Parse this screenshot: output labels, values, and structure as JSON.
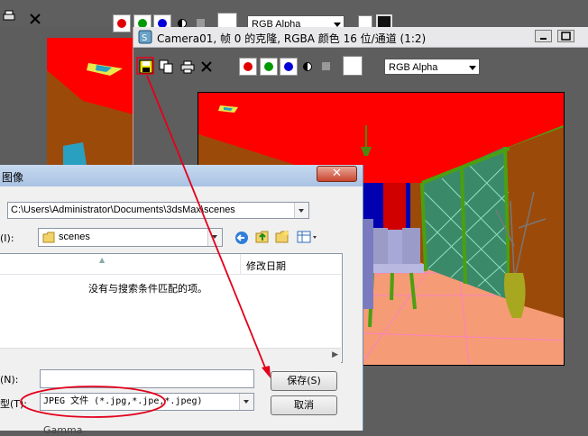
{
  "background_toolbar": {
    "render_channel": "RGB Alpha"
  },
  "camera_window": {
    "title": "Camera01, 帧 0 的克隆, RGBA 颜色 16 位/通道 (1:2)",
    "render_channel": "RGB Alpha"
  },
  "save_dialog": {
    "title": "图像",
    "path": "C:\\Users\\Administrator\\Documents\\3dsMax\\scenes",
    "save_in_label": "(I):",
    "folder": "scenes",
    "column_header_date": "修改日期",
    "empty_message": "没有与搜索条件匹配的项。",
    "filename_label": "(N):",
    "filename_value": "",
    "filetype_label": "型(T):",
    "filetype_value": "JPEG 文件 (*.jpg,*.jpe,*.jpeg)",
    "save_button": "保存(S)",
    "cancel_button": "取消",
    "bottom_text": "Gamma"
  },
  "colors": {
    "annotation_red": "#e3001b",
    "ceiling_red": "#ff0000",
    "wall_brown": "#9c4a0a",
    "floor_salmon": "#f59b76"
  }
}
